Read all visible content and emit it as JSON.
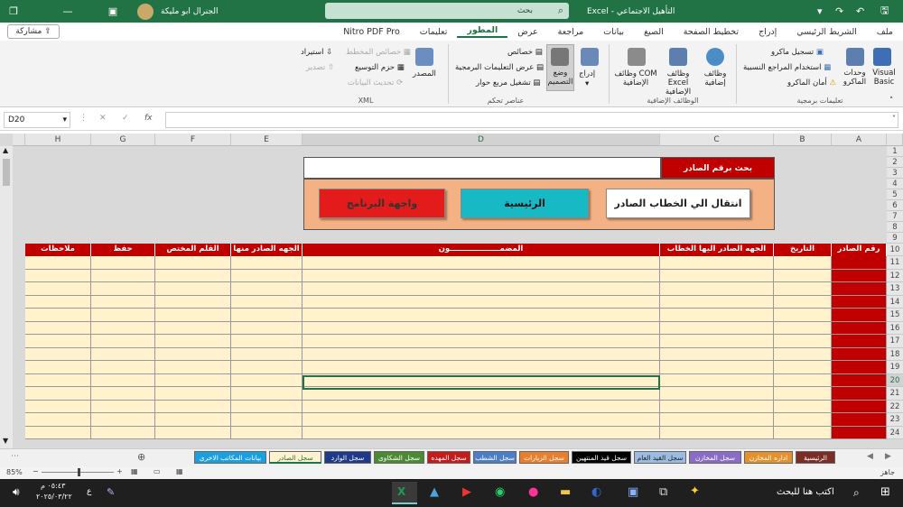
{
  "titlebar": {
    "app": "Excel",
    "doc_title": "التأهيل الاجتماعي",
    "search_placeholder": "بحث",
    "user": "الجنرال ابو مليكة"
  },
  "ribbon": {
    "tabs": [
      "ملف",
      "الشريط الرئيسي",
      "إدراج",
      "تخطيط الصفحة",
      "الصيغ",
      "بيانات",
      "مراجعة",
      "عرض",
      "المطور",
      "تعليمات",
      "Nitro PDF Pro"
    ],
    "active_tab": "المطور",
    "share": "مشاركة",
    "code": {
      "label": "تعليمات برمجية",
      "vb": "Visual Basic",
      "macros": "وحدات الماكرو",
      "record": "تسجيل ماكرو",
      "relative": "استخدام المراجع النسبية",
      "security": "أمان الماكرو"
    },
    "addins": {
      "label": "الوظائف الإضافية",
      "addins": "وظائف إضافية",
      "excel_addins": "وظائف Excel الإضافية",
      "com_addins": "وظائف COM الإضافية"
    },
    "controls": {
      "label": "عناصر تحكم",
      "insert": "إدراج",
      "design": "وضع التصميم",
      "props": "خصائص",
      "view_code": "عرض التعليمات البرمجية",
      "run_dialog": "تشغيل مربع حوار"
    },
    "xml": {
      "label": "XML",
      "source": "المصدر",
      "map_props": "خصائص المخطط",
      "packs": "حزم التوسيع",
      "refresh": "تحديث البيانات",
      "import": "استيراد",
      "export": "تصدير"
    }
  },
  "formula": {
    "namebox": "D20",
    "fx": "fx"
  },
  "columns": [
    "A",
    "B",
    "C",
    "D",
    "E",
    "F",
    "G",
    "H"
  ],
  "rows": [
    "1",
    "2",
    "3",
    "4",
    "5",
    "6",
    "7",
    "8",
    "9",
    "10",
    "11",
    "12",
    "13",
    "14",
    "15",
    "16",
    "17",
    "18",
    "19",
    "20",
    "21",
    "22",
    "23",
    "24"
  ],
  "sheet": {
    "search_label": "بحث برقم الصادر",
    "btn_go": "انتقال الي الخطاب الصادر",
    "btn_home": "الرئيسية",
    "btn_ui": "واجهة البرنامج",
    "headers": [
      "رقم الصادر",
      "التاريخ",
      "الجهه الصادر اليها الخطاب",
      "المضمـــــــــــــــــــون",
      "الجهه الصادر منها",
      "القلم المختص",
      "حفظ",
      "ملاحظات"
    ]
  },
  "sheet_tabs": [
    {
      "label": "الرئيسية",
      "color": "#7b2d26"
    },
    {
      "label": "اداره المخازن",
      "color": "#e4902b"
    },
    {
      "label": "سجل المخازن",
      "color": "#8a6bc8"
    },
    {
      "label": "سجل القيد العام",
      "color": "#9bbbe0"
    },
    {
      "label": "سجل قيد المنتهين",
      "color": "#000000"
    },
    {
      "label": "سجل الزيارات",
      "color": "#e87f2c"
    },
    {
      "label": "سجل الشطب",
      "color": "#4a7fc8"
    },
    {
      "label": "سجل المهده",
      "color": "#c41b1b"
    },
    {
      "label": "سجل الشكاوى",
      "color": "#4b8a33"
    },
    {
      "label": "سجل الوارد",
      "color": "#1f3a8a"
    },
    {
      "label": "سجل الصادر",
      "color": "#fff2cc"
    },
    {
      "label": "بيانات المكاتب الاخرى",
      "color": "#1aa0e0"
    }
  ],
  "status": {
    "ready": "جاهز",
    "zoom": "85%"
  },
  "taskbar": {
    "search": "اكتب هنا للبحث",
    "time": "٠٥:٤٣ م",
    "date": "٢٠٢٥/٠٣/٢٢",
    "lang": "ع"
  }
}
